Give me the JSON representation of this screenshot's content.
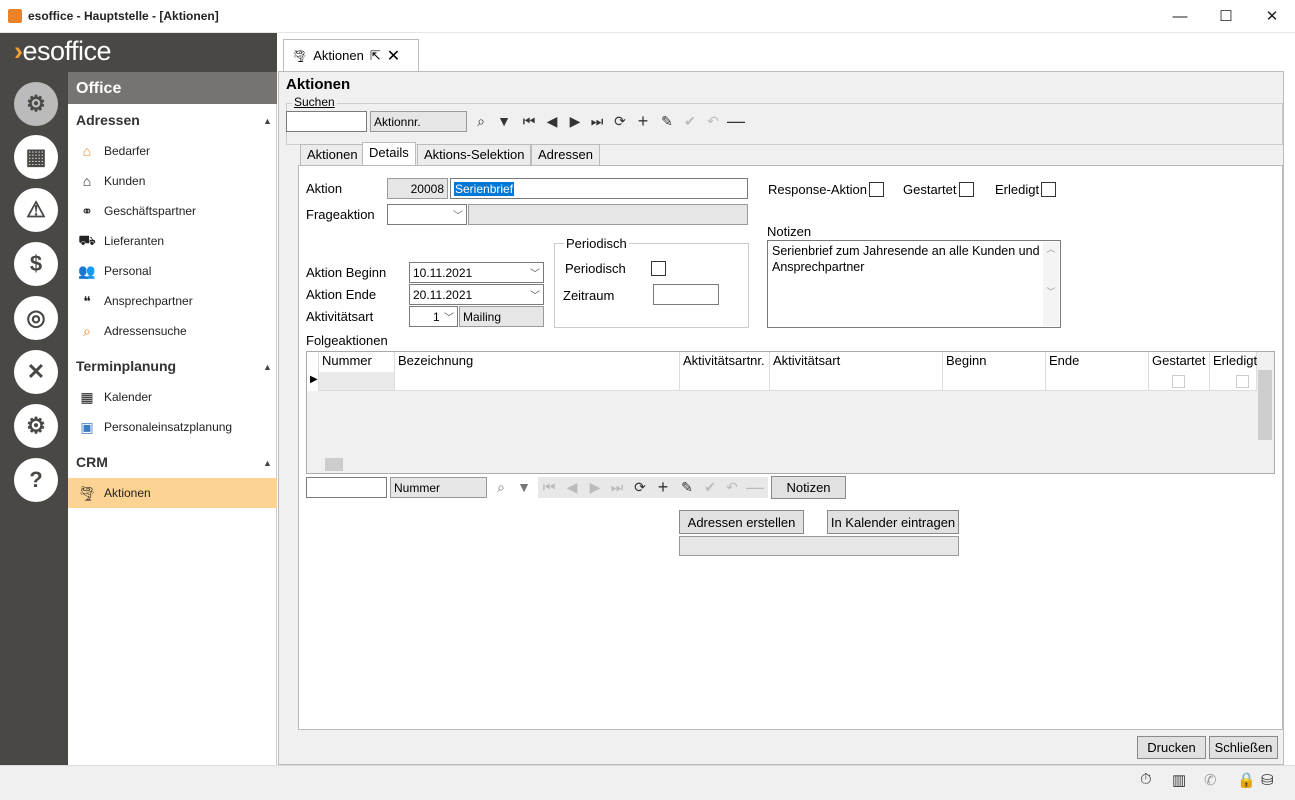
{
  "window": {
    "title": "esoffice - Hauptstelle - [Aktionen]",
    "minimize": "—",
    "maximize": "☐",
    "close": "✕"
  },
  "logo": {
    "chevron": "›",
    "text": "esoffice"
  },
  "rail": [
    {
      "name": "office-icon",
      "glyph": "⚙"
    },
    {
      "name": "planner-icon",
      "glyph": "▦"
    },
    {
      "name": "alarm-icon",
      "glyph": "⚠"
    },
    {
      "name": "money-icon",
      "glyph": "$"
    },
    {
      "name": "headset-icon",
      "glyph": "◎"
    },
    {
      "name": "tools-icon",
      "glyph": "✕"
    },
    {
      "name": "settings-icon",
      "glyph": "⚙"
    },
    {
      "name": "help-icon",
      "glyph": "?"
    }
  ],
  "nav": {
    "office": "Office",
    "sections": [
      {
        "title": "Adressen",
        "items": [
          {
            "label": "Bedarfer",
            "icon": "home-icon",
            "glyph": "⌂"
          },
          {
            "label": "Kunden",
            "icon": "house-icon",
            "glyph": "⌂"
          },
          {
            "label": "Geschäftspartner",
            "icon": "handshake-icon",
            "glyph": "⚭"
          },
          {
            "label": "Lieferanten",
            "icon": "truck-icon",
            "glyph": "⛟"
          },
          {
            "label": "Personal",
            "icon": "people-icon",
            "glyph": "👥"
          },
          {
            "label": "Ansprechpartner",
            "icon": "quote-icon",
            "glyph": "❝"
          },
          {
            "label": "Adressensuche",
            "icon": "address-search-icon",
            "glyph": "⌕"
          }
        ]
      },
      {
        "title": "Terminplanung",
        "items": [
          {
            "label": "Kalender",
            "icon": "calendar-icon",
            "glyph": "▦"
          },
          {
            "label": "Personaleinsatzplanung",
            "icon": "staff-planning-icon",
            "glyph": "▣"
          }
        ]
      },
      {
        "title": "CRM",
        "items": [
          {
            "label": "Aktionen",
            "icon": "tornado-icon",
            "glyph": "🌪"
          }
        ]
      }
    ],
    "caret": "▲"
  },
  "doc_tab": {
    "label": "Aktionen",
    "popout": "⇱",
    "close": "✕"
  },
  "page_title": "Aktionen",
  "search": {
    "legend": "Suchen",
    "value": "",
    "field": "Aktionnr."
  },
  "inner_tabs": [
    "Aktionen",
    "Details",
    "Aktions-Selektion",
    "Adressen"
  ],
  "details": {
    "aktion_label": "Aktion",
    "aktion_nr": "20008",
    "aktion_name": "Serienbrief",
    "frageaktion_label": "Frageaktion",
    "response_label": "Response-Aktion",
    "gestartet_label": "Gestartet",
    "erledigt_label": "Erledigt",
    "notizen_label": "Notizen",
    "notizen_text": "Serienbrief zum Jahresende an alle Kunden und Ansprechpartner",
    "periodisch_group": "Periodisch",
    "periodisch_label": "Periodisch",
    "zeitraum_label": "Zeitraum",
    "beginn_label": "Aktion Beginn",
    "beginn_value": "10.11.2021",
    "ende_label": "Aktion Ende",
    "ende_value": "20.11.2021",
    "aktivitaetsart_label": "Aktivitätsart",
    "aktivitaetsart_nr": "1",
    "aktivitaetsart_name": "Mailing"
  },
  "folgeaktionen": {
    "label": "Folgeaktionen",
    "columns": [
      "Nummer",
      "Bezeichnung",
      "Aktivitätsartnr.",
      "Aktivitätsart",
      "Beginn",
      "Ende",
      "Gestartet",
      "Erledigt"
    ],
    "search_field": "Nummer",
    "notizen_button": "Notizen"
  },
  "buttons": {
    "adressen_erstellen": "Adressen erstellen",
    "kalender_eintragen": "In Kalender eintragen",
    "drucken": "Drucken",
    "schliessen": "Schließen"
  }
}
